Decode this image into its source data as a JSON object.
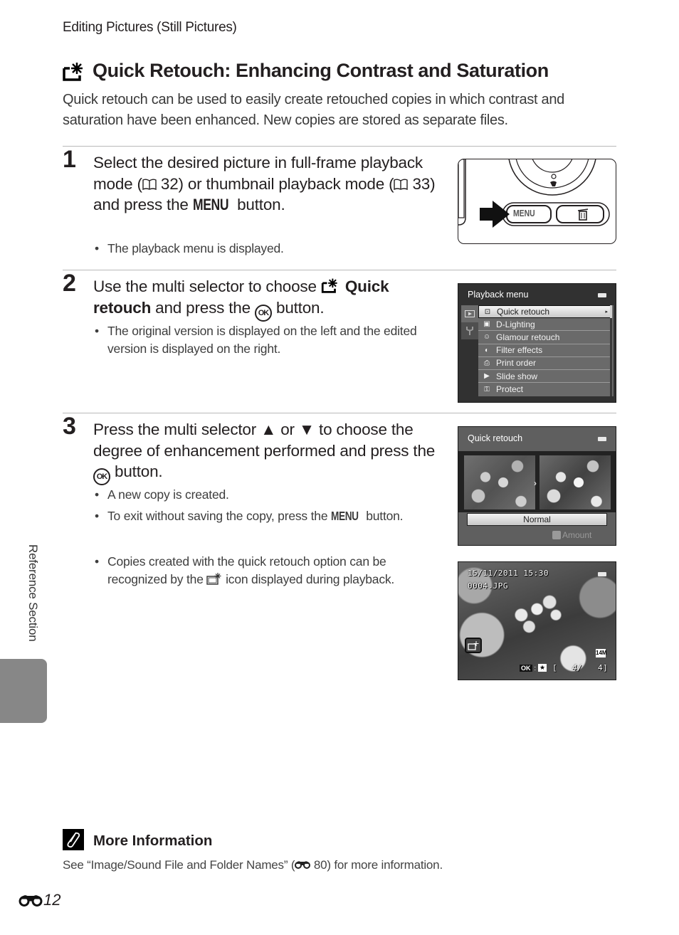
{
  "running_head": "Editing Pictures (Still Pictures)",
  "title": "Quick Retouch: Enhancing Contrast and Saturation",
  "intro": "Quick retouch can be used to easily create retouched copies in which contrast and saturation have been enhanced. New copies are stored as separate files.",
  "steps": [
    {
      "number": "1",
      "text_parts": [
        "Select the desired picture in full-frame playback mode (",
        " 32) or thumbnail playback mode (",
        " 33) and press the ",
        " button."
      ],
      "menu_word": "MENU",
      "bullets": [
        "The playback menu is displayed."
      ]
    },
    {
      "number": "2",
      "text_parts": [
        "Use the multi selector to choose ",
        " and press the ",
        " button."
      ],
      "bold": "Quick retouch",
      "ok_word": "OK",
      "bullets": [
        "The original version is displayed on the left and the edited version is displayed on the right."
      ]
    },
    {
      "number": "3",
      "text_parts": [
        "Press the multi selector ",
        " or ",
        " to choose the degree of enhancement performed and press the ",
        " button."
      ],
      "up_glyph": "▲",
      "down_glyph": "▼",
      "ok_word": "OK",
      "bullets": [
        "A new copy is created."
      ],
      "bullet2_parts": [
        "To exit without saving the copy, press the ",
        " button."
      ],
      "menu_word": "MENU",
      "note_parts": [
        "Copies created with the quick retouch option can be recognized by the ",
        " icon displayed during playback."
      ]
    }
  ],
  "camera_illustration": {
    "menu_button": "MENU",
    "delete_icon": "trash-icon"
  },
  "playback_menu": {
    "title": "Playback menu",
    "items": [
      {
        "label": "Quick retouch",
        "icon": "quick-retouch-icon",
        "selected": true
      },
      {
        "label": "D-Lighting",
        "icon": "d-lighting-icon"
      },
      {
        "label": "Glamour retouch",
        "icon": "glamour-retouch-icon"
      },
      {
        "label": "Filter effects",
        "icon": "filter-effects-icon"
      },
      {
        "label": "Print order",
        "icon": "print-order-icon"
      },
      {
        "label": "Slide show",
        "icon": "slide-show-icon"
      },
      {
        "label": "Protect",
        "icon": "protect-icon"
      }
    ]
  },
  "quick_retouch_screen": {
    "title": "Quick retouch",
    "value": "Normal",
    "amount_label": "Amount"
  },
  "playback_screen": {
    "datetime": "15/11/2011 15:30",
    "filename": "0004.JPG",
    "image_size": "14M",
    "ok_label": "OK",
    "frame_left": "[",
    "frame_mid": "4/",
    "frame_right": "4]"
  },
  "side_tab": "Reference Section",
  "more_info": {
    "title": "More Information",
    "text_before": "See “Image/Sound File and Folder Names” (",
    "ref": " 80",
    "text_after": ") for more information."
  },
  "page_number": "12"
}
